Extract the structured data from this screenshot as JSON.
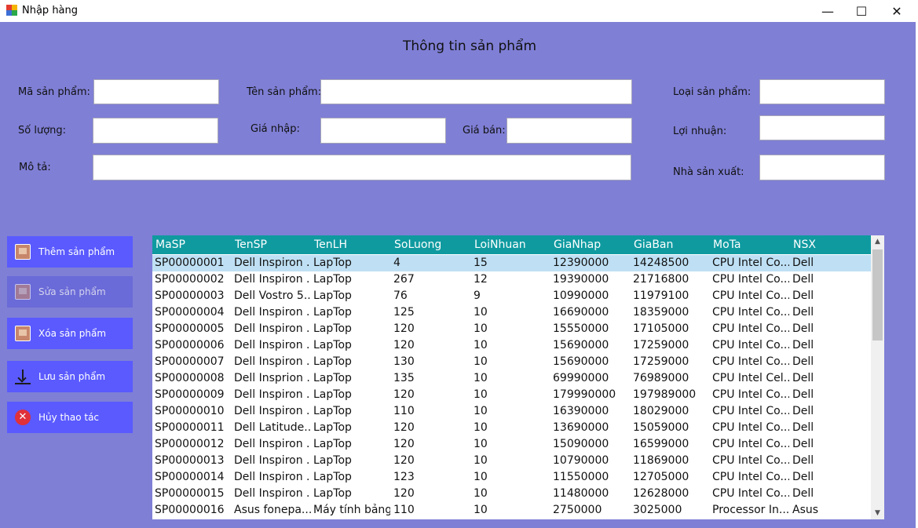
{
  "window": {
    "title": "Nhập hàng",
    "minimize": "—",
    "maximize": "☐",
    "close": "✕"
  },
  "form": {
    "heading": "Thông tin sản phẩm",
    "labels": {
      "ma_sp": "Mã sản phẩm:",
      "ten_sp": "Tên sản phẩm:",
      "loai_sp": "Loại sản phẩm:",
      "so_luong": "Số lượng:",
      "gia_nhap": "Giá nhập:",
      "gia_ban": "Giá bán:",
      "loi_nhuan": "Lợi nhuận:",
      "mo_ta": "Mô tả:",
      "nha_sx": "Nhà sản xuất:"
    },
    "values": {
      "ma_sp": "",
      "ten_sp": "",
      "loai_sp": "",
      "so_luong": "",
      "gia_nhap": "",
      "gia_ban": "",
      "loi_nhuan": "",
      "mo_ta": "",
      "nha_sx": ""
    }
  },
  "actions": [
    {
      "label": "Thêm sản phẩm",
      "icon": "add-product-icon",
      "enabled": true
    },
    {
      "label": "Sửa sản phẩm",
      "icon": "edit-product-icon",
      "enabled": false
    },
    {
      "label": "Xóa sản phẩm",
      "icon": "delete-product-icon",
      "enabled": true
    },
    {
      "label": "Lưu sản phẩm",
      "icon": "download-save-icon",
      "enabled": true
    },
    {
      "label": "Hủy thao tác",
      "icon": "cancel-x-icon",
      "enabled": true
    }
  ],
  "grid": {
    "columns": [
      "MaSP",
      "TenSP",
      "TenLH",
      "SoLuong",
      "LoiNhuan",
      "GiaNhap",
      "GiaBan",
      "MoTa",
      "NSX"
    ],
    "selected_row": 0,
    "rows": [
      [
        "SP00000001",
        "Dell Inspiron ...",
        "LapTop",
        "4",
        "15",
        "12390000",
        "14248500",
        "CPU Intel Co...",
        "Dell"
      ],
      [
        "SP00000002",
        "Dell Inspiron ...",
        "LapTop",
        "267",
        "12",
        "19390000",
        "21716800",
        "CPU Intel Co...",
        "Dell"
      ],
      [
        "SP00000003",
        "Dell Vostro 5...",
        "LapTop",
        "76",
        "9",
        "10990000",
        "11979100",
        "CPU Intel Co...",
        "Dell"
      ],
      [
        "SP00000004",
        "Dell Inspiron ...",
        "LapTop",
        "125",
        "10",
        "16690000",
        "18359000",
        "CPU Intel Co...",
        "Dell"
      ],
      [
        "SP00000005",
        "Dell Inspiron ...",
        "LapTop",
        "120",
        "10",
        "15550000",
        "17105000",
        "CPU Intel Co...",
        "Dell"
      ],
      [
        "SP00000006",
        "Dell Inspiron ...",
        "LapTop",
        "120",
        "10",
        "15690000",
        "17259000",
        "CPU Intel Co...",
        "Dell"
      ],
      [
        "SP00000007",
        "Dell Inspiron ...",
        "LapTop",
        "130",
        "10",
        "15690000",
        "17259000",
        "CPU Intel Co...",
        "Dell"
      ],
      [
        "SP00000008",
        "Dell Insprion ...",
        "LapTop",
        "135",
        "10",
        "69990000",
        "76989000",
        "CPU Intel Cel...",
        "Dell"
      ],
      [
        "SP00000009",
        "Dell Inspiron ...",
        "LapTop",
        "120",
        "10",
        "179990000",
        "197989000",
        "CPU Intel Co...",
        "Dell"
      ],
      [
        "SP00000010",
        "Dell Inspiron ...",
        "LapTop",
        "110",
        "10",
        "16390000",
        "18029000",
        "CPU Intel Co...",
        "Dell"
      ],
      [
        "SP00000011",
        "Dell Latitude...",
        "LapTop",
        "120",
        "10",
        "13690000",
        "15059000",
        "CPU Intel Co...",
        "Dell"
      ],
      [
        "SP00000012",
        "Dell Inspiron ...",
        "LapTop",
        "120",
        "10",
        "15090000",
        "16599000",
        "CPU Intel Co...",
        "Dell"
      ],
      [
        "SP00000013",
        "Dell Inspiron ...",
        "LapTop",
        "120",
        "10",
        "10790000",
        "11869000",
        "CPU Intel Co...",
        "Dell"
      ],
      [
        "SP00000014",
        "Dell Inspiron ...",
        "LapTop",
        "123",
        "10",
        "11550000",
        "12705000",
        "CPU Intel Co...",
        "Dell"
      ],
      [
        "SP00000015",
        "Dell Inspiron ...",
        "LapTop",
        "120",
        "10",
        "11480000",
        "12628000",
        "CPU Intel Co...",
        "Dell"
      ],
      [
        "SP00000016",
        "Asus fonepa...",
        "Máy tính bảng",
        "110",
        "10",
        "2750000",
        "3025000",
        "Processor In...",
        "Asus"
      ]
    ]
  },
  "colors": {
    "background": "#7f7fd6",
    "button": "#5a5aff",
    "button_disabled": "#6a6ad8",
    "grid_header": "#0f9aa0",
    "selection": "#bfe0f4"
  }
}
